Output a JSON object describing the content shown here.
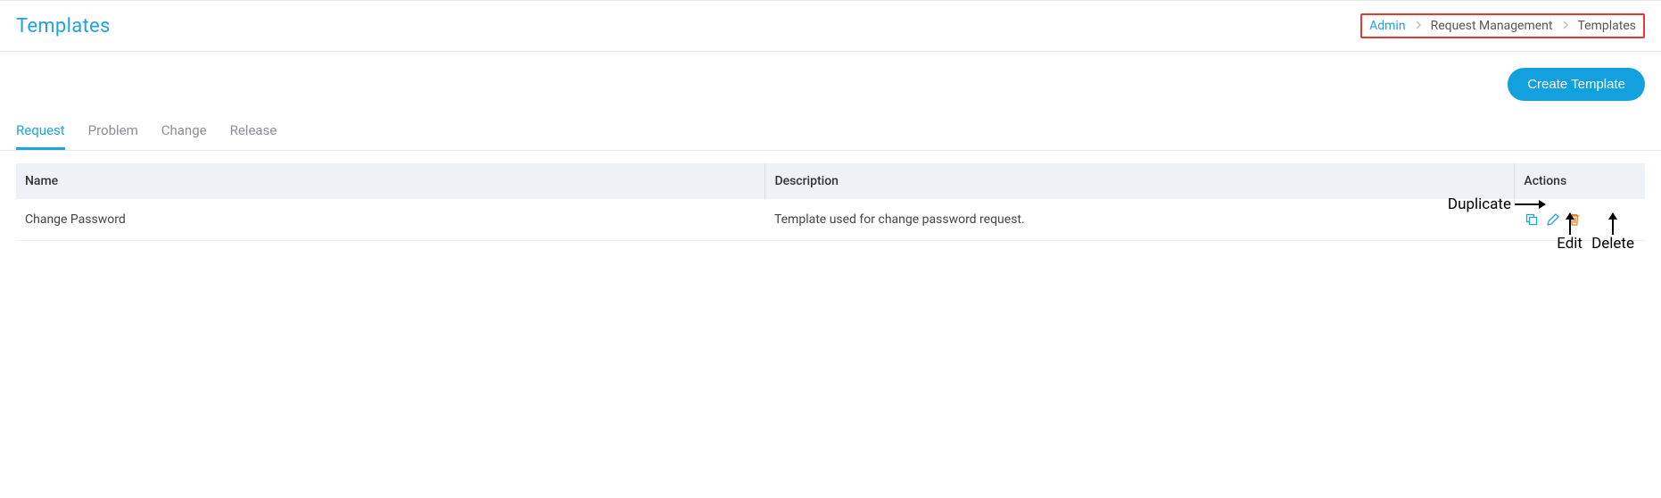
{
  "header": {
    "title": "Templates"
  },
  "breadcrumb": {
    "admin": "Admin",
    "request_mgmt": "Request Management",
    "templates": "Templates"
  },
  "toolbar": {
    "create": "Create Template"
  },
  "tabs": {
    "request": "Request",
    "problem": "Problem",
    "change": "Change",
    "release": "Release"
  },
  "table": {
    "headers": {
      "name": "Name",
      "description": "Description",
      "actions": "Actions"
    },
    "rows": [
      {
        "name": "Change Password",
        "description": "Template used for change password request."
      }
    ]
  },
  "annotations": {
    "duplicate": "Duplicate",
    "edit": "Edit",
    "delete": "Delete"
  }
}
